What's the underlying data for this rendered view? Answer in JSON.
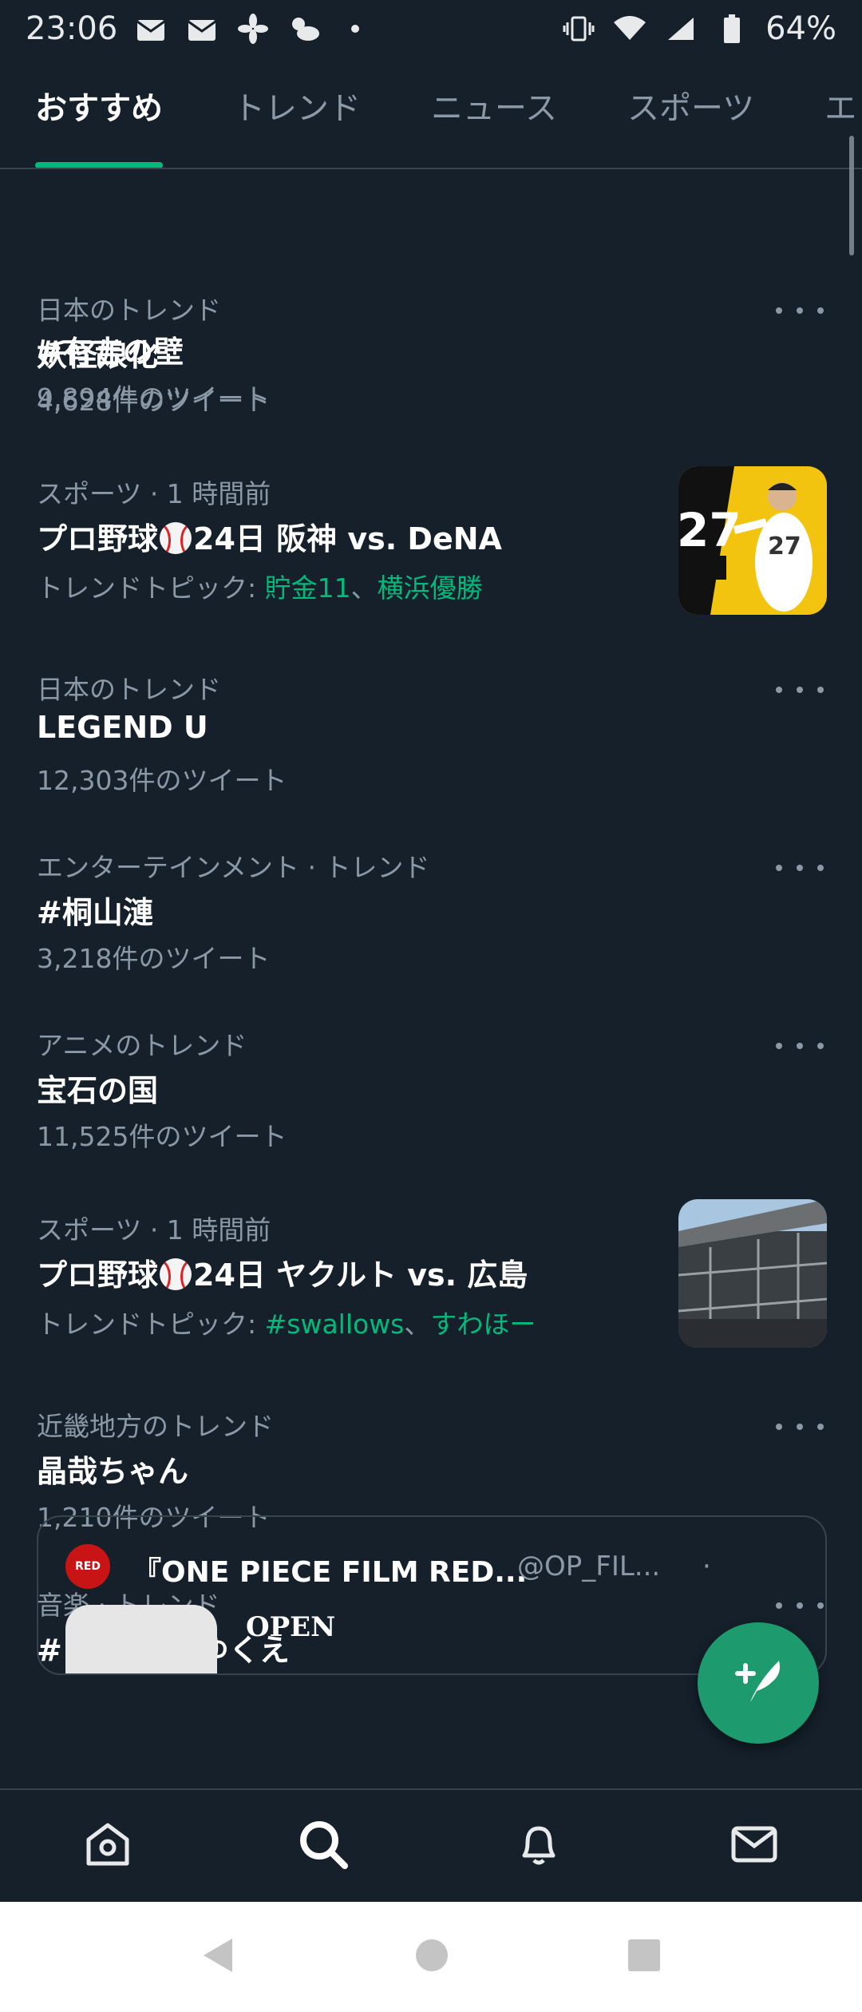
{
  "status_bar": {
    "time": "23:06",
    "battery": "64%"
  },
  "tabs": [
    {
      "label": "おすすめ",
      "active": true
    },
    {
      "label": "トレンド"
    },
    {
      "label": "ニュース"
    },
    {
      "label": "スポーツ"
    },
    {
      "label": "エ"
    }
  ],
  "trends": [
    {
      "title": "#有吉の壁",
      "count": "9,894件のツイート"
    },
    {
      "meta": "日本のトレンド",
      "title": "妖怪娘化",
      "count": "4,628件のツイート"
    },
    {
      "meta": "スポーツ · 1 時間前",
      "title_prefix": "プロ野球",
      "title_suffix": "24日 阪神 vs. DeNA",
      "topics_label": "トレンドトピック: ",
      "topic1": "貯金11",
      "sep": "、",
      "topic2": "横浜優勝"
    },
    {
      "meta": "日本のトレンド",
      "title": "LEGEND U",
      "count": "12,303件のツイート"
    },
    {
      "meta": "エンターテインメント · トレンド",
      "title": "#桐山漣",
      "count": "3,218件のツイート"
    },
    {
      "meta": "アニメのトレンド",
      "title": "宝石の国",
      "count": "11,525件のツイート"
    },
    {
      "meta": "スポーツ · 1 時間前",
      "title_prefix": "プロ野球",
      "title_suffix": "24日 ヤクルト vs. 広島",
      "topics_label": "トレンドトピック: ",
      "topic1": "#swallows",
      "sep": "、",
      "topic2": "すわほー"
    },
    {
      "meta": "近畿地方のトレンド",
      "title": "晶哉ちゃん",
      "count": "1,210件のツイート"
    },
    {
      "meta": "音楽 · トレンド",
      "title": "#ウタ_風のゆくえ"
    }
  ],
  "tweet_card": {
    "avatar_text": "RED",
    "name": "『ONE PIECE FILM RED...",
    "handle": "@OP_FIL...",
    "dot": "·",
    "text": "OPEN"
  },
  "colors": {
    "background": "#15202b",
    "accent": "#00ba7c",
    "muted": "#8b98a5"
  }
}
